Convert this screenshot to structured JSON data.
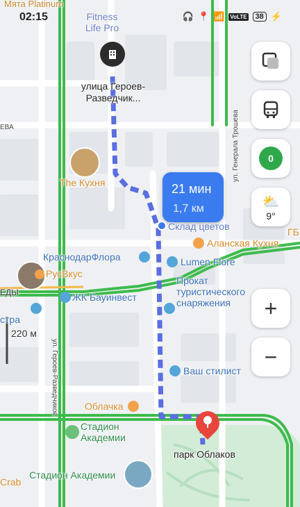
{
  "status_bar": {
    "time": "02:15",
    "network": "VoLTE",
    "battery": "38"
  },
  "map_labels": {
    "top_shop": "Мята Platinum",
    "fitness": "Fitness Life Pro",
    "start_street": "улица Героев-Разведчик...",
    "the_kitchen": "The Кухня",
    "flower_warehouse": "Склад цветов",
    "alanskaya": "Аланская Кухня",
    "krasnodarflora": "КраснодарФлора",
    "lumen": "Lumen Flore",
    "rusvkus": "РусВкус",
    "zhk": "ЖК Бауинвест",
    "rental_line1": "Прокат",
    "rental_line2": "туристического",
    "rental_line3": "снаряжения",
    "stylist": "Ваш стилист",
    "oblachka": "Облачка",
    "stadium_line1": "Стадион",
    "stadium_line2": "Академии",
    "stadium_full": "Стадион Академии",
    "destination": "парк Облаков",
    "crab": "Crab",
    "street_vertical_left": "ул. Героев-Разведчиков",
    "street_vertical_right": "ул. Генерала Трошева",
    "street_left_cut": "ЕВА",
    "street_left_cut2": "ЕДЫ",
    "left_partial": "стра",
    "right_partial": "ГБ",
    "scale": "220 м"
  },
  "route": {
    "time": "21 мин",
    "distance": "1,7 км"
  },
  "controls": {
    "layers_icon": "layers-icon",
    "transit_icon": "bus-icon",
    "traffic_score": "0",
    "weather_temp": "9°",
    "zoom_in": "+",
    "zoom_out": "−"
  },
  "colors": {
    "route": "#5b6ee0",
    "route_card": "#3a7bf0",
    "green_road": "#3dbb4b",
    "park": "#cfead3",
    "traffic": "#2ea84a",
    "pin": "#e8453c"
  }
}
